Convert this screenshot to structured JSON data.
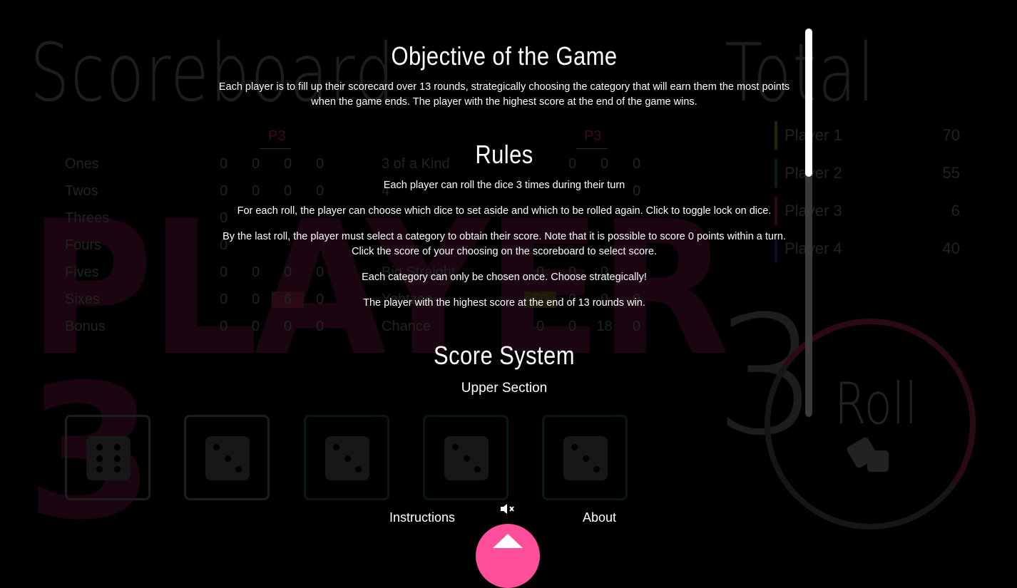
{
  "background": {
    "scoreboard_title": "Scoreboard",
    "total_title": "Total",
    "player_watermark": "PLAYER",
    "player_number_watermark": "3",
    "upper": {
      "column_header": "P3",
      "rows": [
        {
          "label": "Ones",
          "values": [
            "0",
            "0",
            "0",
            "0"
          ]
        },
        {
          "label": "Twos",
          "values": [
            "0",
            "0",
            "0",
            "0"
          ]
        },
        {
          "label": "Threes",
          "values": [
            "0",
            "",
            "",
            ""
          ]
        },
        {
          "label": "Fours",
          "values": [
            "0",
            "",
            "",
            ""
          ]
        },
        {
          "label": "Fives",
          "values": [
            "0",
            "0",
            "0",
            "0"
          ]
        },
        {
          "label": "Sixes",
          "values": [
            "0",
            "0",
            "6",
            "0"
          ]
        },
        {
          "label": "Bonus",
          "values": [
            "0",
            "0",
            "0",
            "0"
          ]
        }
      ]
    },
    "lower": {
      "column_header": "P3",
      "rows": [
        {
          "label": "3 of a Kind",
          "values": [
            "",
            "0",
            "0",
            "0"
          ]
        },
        {
          "label": "4",
          "values": [
            "",
            "",
            "",
            "0"
          ]
        },
        {
          "label": "",
          "values": [
            "",
            "",
            "",
            ""
          ]
        },
        {
          "label": "",
          "values": [
            "",
            "",
            "",
            ""
          ]
        },
        {
          "label": "Big Straight",
          "values": [
            "0",
            "0",
            "0",
            ""
          ]
        },
        {
          "label": "Yahtzee",
          "values": [
            "50",
            "0",
            "0",
            "0"
          ]
        },
        {
          "label": "Chance",
          "values": [
            "0",
            "0",
            "18",
            "0"
          ]
        }
      ]
    },
    "standings": [
      {
        "name": "Player 1",
        "points": "70",
        "color": "#2a2406"
      },
      {
        "name": "Player 2",
        "points": "55",
        "color": "#072012"
      },
      {
        "name": "Player 3",
        "points": "6",
        "color": "#2a0a14"
      },
      {
        "name": "Player 4",
        "points": "40",
        "color": "#0a0c24"
      }
    ],
    "rolls_left": "3",
    "roll_label": "Roll",
    "dice": [
      6,
      3,
      3,
      3,
      3
    ]
  },
  "modal": {
    "objective_title": "Objective of the Game",
    "objective_text": "Each player is to fill up their scorecard over 13 rounds, strategically choosing the category that will earn them the most points when the game ends. The player with the highest score at the end of the game wins.",
    "rules_title": "Rules",
    "rules": [
      "Each player can roll the dice 3 times during their turn",
      "For each roll, the player can choose which dice to set aside and which to be rolled again. Click to toggle lock on dice.",
      "By the last roll, the player must select a category to obtain their score. Note that it is possible to score 0 points within a turn. Click the score of your choosing on the scoreboard to select score.",
      "Each category can only be chosen once. Choose strategically!",
      "The player with the highest score at the end of 13 rounds win."
    ],
    "score_title": "Score System",
    "score_subtitle": "Upper Section"
  },
  "footer": {
    "instructions_label": "Instructions",
    "about_label": "About",
    "accent_color": "#ff4f9a"
  }
}
